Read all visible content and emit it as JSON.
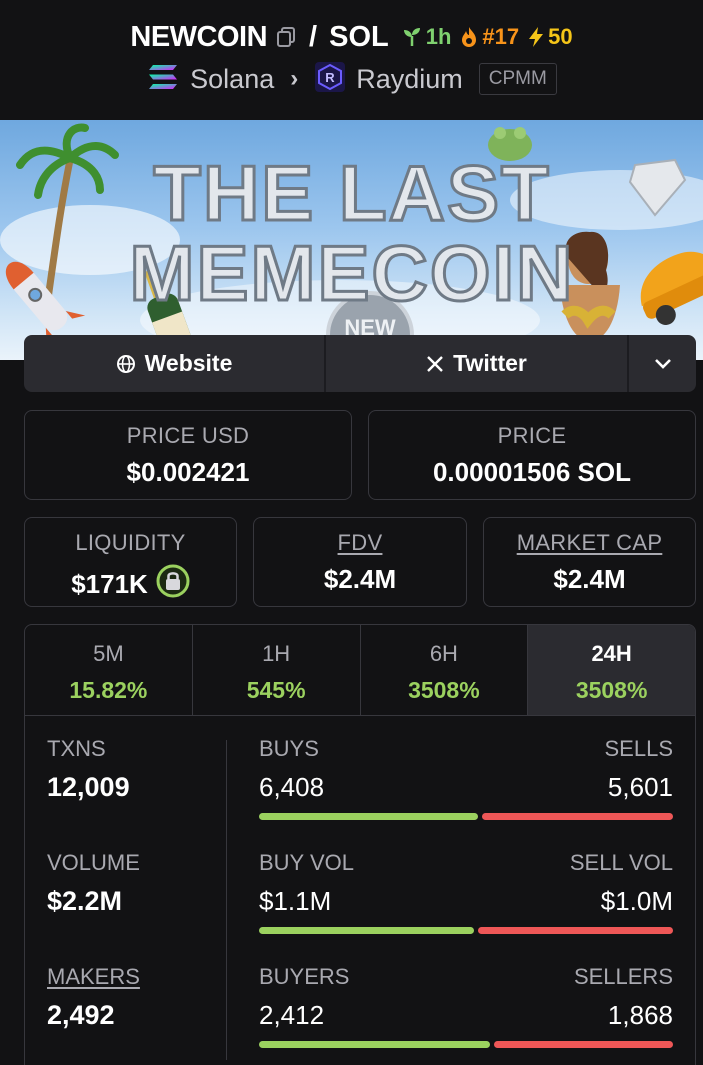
{
  "header": {
    "base_symbol": "NEWCOIN",
    "separator": "/",
    "quote_symbol": "SOL",
    "age": "1h",
    "rank": "#17",
    "boosts": "50",
    "chain": "Solana",
    "dex": "Raydium",
    "pool_type": "CPMM"
  },
  "banner": {
    "line1": "THE LAST",
    "line2": "MEMECOIN",
    "stamp": "NEW"
  },
  "links": {
    "website": "Website",
    "twitter": "Twitter"
  },
  "stats": {
    "price_usd_label": "PRICE USD",
    "price_usd": "$0.002421",
    "price_label": "PRICE",
    "price": "0.00001506 SOL",
    "liquidity_label": "LIQUIDITY",
    "liquidity": "$171K",
    "fdv_label": "FDV",
    "fdv": "$2.4M",
    "mcap_label": "MARKET CAP",
    "mcap": "$2.4M"
  },
  "timeframes": [
    {
      "label": "5M",
      "change": "15.82%"
    },
    {
      "label": "1H",
      "change": "545%"
    },
    {
      "label": "6H",
      "change": "3508%"
    },
    {
      "label": "24H",
      "change": "3508%"
    }
  ],
  "activity": {
    "txns_label": "TXNS",
    "txns": "12,009",
    "volume_label": "VOLUME",
    "volume": "$2.2M",
    "makers_label": "MAKERS",
    "makers": "2,492",
    "buys_label": "BUYS",
    "buys": "6,408",
    "sells_label": "SELLS",
    "sells": "5,601",
    "buys_share": 0.534,
    "buy_vol_label": "BUY VOL",
    "buy_vol": "$1.1M",
    "sell_vol_label": "SELL VOL",
    "sell_vol": "$1.0M",
    "buy_vol_share": 0.524,
    "buyers_label": "BUYERS",
    "buyers": "2,412",
    "sellers_label": "SELLERS",
    "sellers": "1,868",
    "buyers_share": 0.564
  },
  "colors": {
    "positive": "#9bd15f",
    "negative": "#ee5757",
    "age": "#7fd16f",
    "rank": "#f7931a",
    "boost": "#f5c518"
  }
}
